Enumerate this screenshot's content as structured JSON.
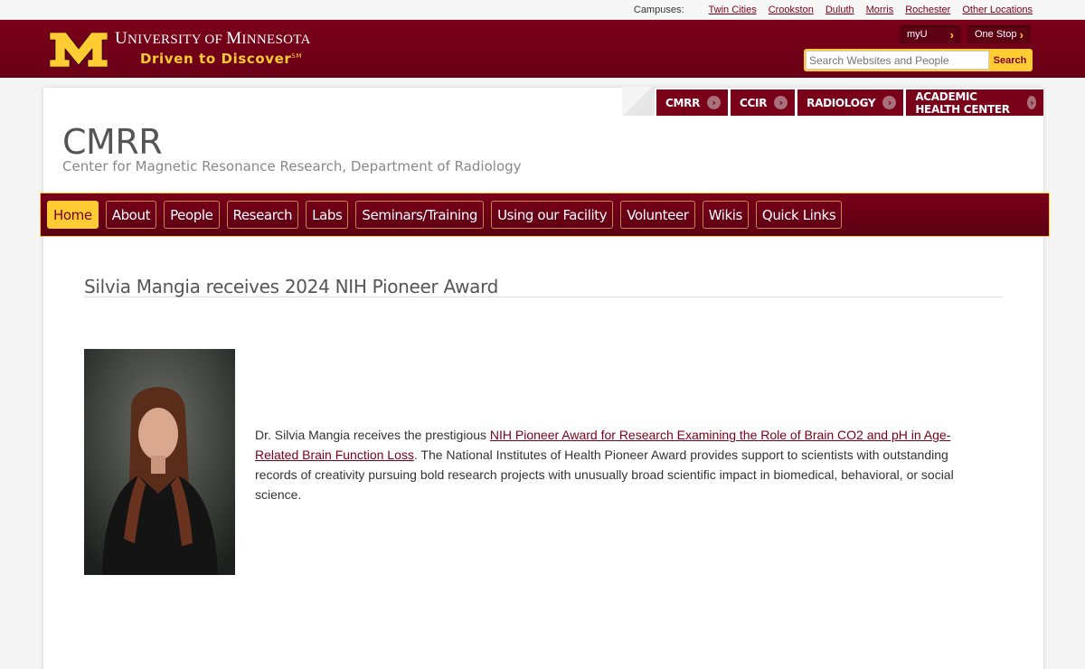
{
  "campus_bar": {
    "label": "Campuses:",
    "links": [
      "Twin Cities",
      "Crookston",
      "Duluth",
      "Morris",
      "Rochester",
      "Other Locations"
    ]
  },
  "header": {
    "university_U": "U",
    "university_rest1": "NIVERSITY OF ",
    "university_M": "M",
    "university_rest2": "INNESOTA",
    "tagline": "Driven to Discover",
    "tagline_mark": "SM",
    "myu_label": "myU",
    "onestop_label": "One Stop",
    "search_placeholder": "Search Websites and People",
    "search_button": "Search"
  },
  "site_tabs": [
    "CMRR",
    "CCIR",
    "RADIOLOGY",
    "ACADEMIC HEALTH CENTER"
  ],
  "site": {
    "title": "CMRR",
    "subtitle": "Center for Magnetic Resonance Research, Department of Radiology"
  },
  "nav": {
    "items": [
      "Home",
      "About",
      "People",
      "Research",
      "Labs",
      "Seminars/Training",
      "Using our Facility",
      "Volunteer",
      "Wikis",
      "Quick Links"
    ],
    "active": "Home"
  },
  "article": {
    "headline": "Silvia Mangia receives 2024 NIH Pioneer Award",
    "text_before": "Dr. Silvia Mangia receives the prestigious ",
    "link_text": "NIH Pioneer Award for Research Examining the Role of Brain CO2 and pH in Age-Related Brain Function Loss",
    "text_after": ". The National Institutes of Health Pioneer Award provides support to scientists with outstanding records of creativity pursuing bold research projects with unusually broad scientific impact in biomedical, behavioral, or social science."
  },
  "colors": {
    "maroon": "#7a0019",
    "gold": "#ffcc33"
  }
}
